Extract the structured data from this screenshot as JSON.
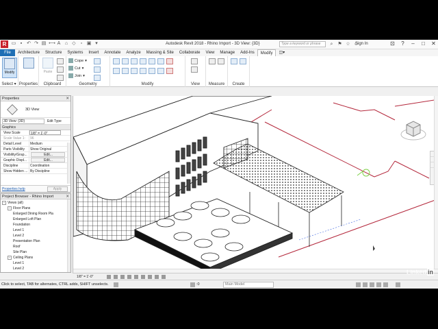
{
  "titlebar": {
    "logo": "R",
    "title": "Autodesk Revit 2018 -    Rhino Import - 3D View: {3D}",
    "search_placeholder": "Type a keyword or phrase",
    "signin": "Sign In"
  },
  "tabs": [
    "File",
    "Architecture",
    "Structure",
    "Systems",
    "Insert",
    "Annotate",
    "Analyze",
    "Massing & Site",
    "Collaborate",
    "View",
    "Manage",
    "Add-Ins",
    "Modify"
  ],
  "active_tab": "Modify",
  "ribbon": {
    "select_group": {
      "modify_label": "Modify",
      "label": "Select ▾"
    },
    "properties_group": {
      "label": "Properties"
    },
    "clipboard_group": {
      "paste_label": "Paste",
      "label": "Clipboard"
    },
    "geometry_group": {
      "cope_label": "Cope",
      "cut_label": "Cut",
      "join_label": "Join",
      "label": "Geometry"
    },
    "modify_group": {
      "label": "Modify"
    },
    "view_group": {
      "label": "View"
    },
    "measure_group": {
      "label": "Measure"
    },
    "create_group": {
      "label": "Create"
    }
  },
  "properties": {
    "header": "Properties",
    "type_name": "3D View",
    "selector": "3D View: {3D}",
    "edit_type": "Edit Type",
    "section": "Graphics",
    "rows": [
      {
        "key": "View Scale",
        "value": "1/8\" = 1'-0\"",
        "style": "boxed"
      },
      {
        "key": "Scale Value    1:",
        "value": "96",
        "style": "dim"
      },
      {
        "key": "Detail Level",
        "value": "Medium",
        "style": ""
      },
      {
        "key": "Parts Visibility",
        "value": "Show Original",
        "style": ""
      },
      {
        "key": "Visibility/Grap...",
        "value": "Edit...",
        "style": "btn"
      },
      {
        "key": "Graphic Displ...",
        "value": "Edit...",
        "style": "btn"
      },
      {
        "key": "Discipline",
        "value": "Coordination",
        "style": ""
      },
      {
        "key": "Show Hidden ...",
        "value": "By Discipline",
        "style": ""
      }
    ],
    "help_link": "Properties help",
    "apply": "Apply"
  },
  "project_browser": {
    "header": "Project Browser - Rhino Import",
    "nodes": [
      {
        "label": "Views (all)",
        "toggle": "-",
        "level": 0
      },
      {
        "label": "Floor Plans",
        "toggle": "-",
        "level": 1
      },
      {
        "label": "Enlarged Dining Room Pla",
        "toggle": "",
        "level": 2
      },
      {
        "label": "Enlarged Loft Plan",
        "toggle": "",
        "level": 2
      },
      {
        "label": "Foundation",
        "toggle": "",
        "level": 2
      },
      {
        "label": "Level 1",
        "toggle": "",
        "level": 2
      },
      {
        "label": "Level 2",
        "toggle": "",
        "level": 2
      },
      {
        "label": "Presentation Plan",
        "toggle": "",
        "level": 2
      },
      {
        "label": "Roof",
        "toggle": "",
        "level": 2
      },
      {
        "label": "Site Plan",
        "toggle": "",
        "level": 2
      },
      {
        "label": "Ceiling Plans",
        "toggle": "-",
        "level": 1
      },
      {
        "label": "Level 1",
        "toggle": "",
        "level": 2
      },
      {
        "label": "Level 2",
        "toggle": "",
        "level": 2
      }
    ]
  },
  "view_control": {
    "scale": "1/8\" = 1'-0\""
  },
  "status": {
    "message": "Click to select, TAB for alternates, CTRL adds, SHIFT unselects.",
    "zero": ":0",
    "model": "Main Model"
  },
  "watermark": {
    "text": "Linked",
    "suffix": "in"
  },
  "colors": {
    "accent": "#1f6fb5",
    "logo": "#c8202a",
    "model_line": "#b3263a"
  },
  "icons": [
    "revit-logo",
    "open-icon",
    "save-icon",
    "undo-icon",
    "redo-icon",
    "print-icon",
    "search-icon",
    "user-icon",
    "help-icon",
    "minimize-icon",
    "maximize-icon",
    "close-icon",
    "view-cube-icon"
  ]
}
